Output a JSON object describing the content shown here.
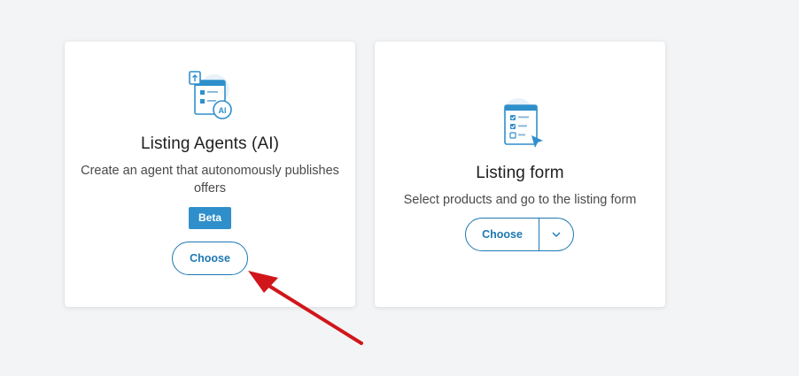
{
  "cards": [
    {
      "title": "Listing Agents (AI)",
      "description": "Create an agent that autonomously publishes offers",
      "badge": "Beta",
      "button_label": "Choose",
      "icon": "document-ai-icon"
    },
    {
      "title": "Listing form",
      "description": "Select products and go to the listing form",
      "button_label": "Choose",
      "dropdown_icon": "chevron-down-icon",
      "icon": "checklist-cursor-icon"
    }
  ],
  "colors": {
    "accent": "#1e78b4",
    "badge": "#2f8fcb",
    "annotation_arrow": "#d0161a"
  }
}
